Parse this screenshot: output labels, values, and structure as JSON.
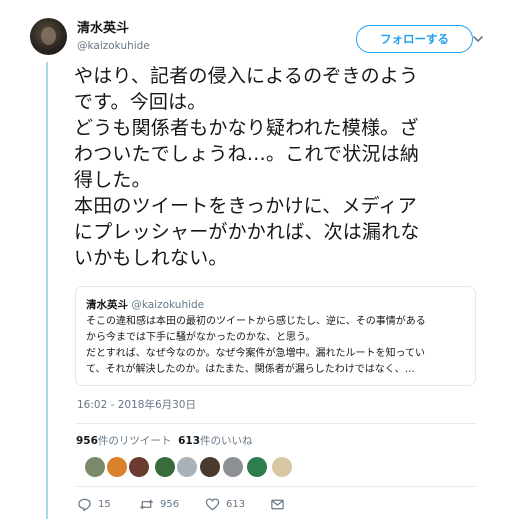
{
  "author": {
    "name": "清水英斗",
    "handle": "@kaizokuhide"
  },
  "follow_button": "フォローする",
  "tweet_lines": [
    "やはり、記者の侵入によるのぞきのよう",
    "です。今回は。",
    "どうも関係者もかなり疑われた模様。ざ",
    "わついたでしょうね…。これで状況は納",
    "得した。",
    "本田のツイートをきっかけに、メディア",
    "にプレッシャーがかかれば、次は漏れな",
    "いかもしれない。"
  ],
  "quote": {
    "name": "清水英斗",
    "handle": "@kaizokuhide",
    "lines": [
      "そこの違和感は本田の最初のツイートから感じたし、逆に、その事情がある",
      "から今までは下手に騒がなかったのかな、と思う。",
      "だとすれば、なぜ今なのか。なぜ今案件が急増中。漏れたルートを知ってい",
      "て、それが解決したのか。はたまた、関係者が漏らしたわけではなく、…"
    ]
  },
  "timestamp": "16:02 - 2018年6月30日",
  "stats": {
    "retweets_count": "956",
    "retweets_label": "件のリツイート",
    "likes_count": "613",
    "likes_label": "件のいいね"
  },
  "liker_colors": [
    "#7b8a6a",
    "#d9822b",
    "#6b3b2f",
    "#3a6b3a",
    "#a9b2b9",
    "#4a3a2e",
    "#8c8f93",
    "#2e7d4f",
    "#d8c7a3"
  ],
  "actions": {
    "reply_count": "15",
    "retweet_count": "956",
    "like_count": "613"
  },
  "colors": {
    "accent": "#1da1f2",
    "thread_line": "#a8d8f0",
    "secondary_text": "#657786"
  }
}
